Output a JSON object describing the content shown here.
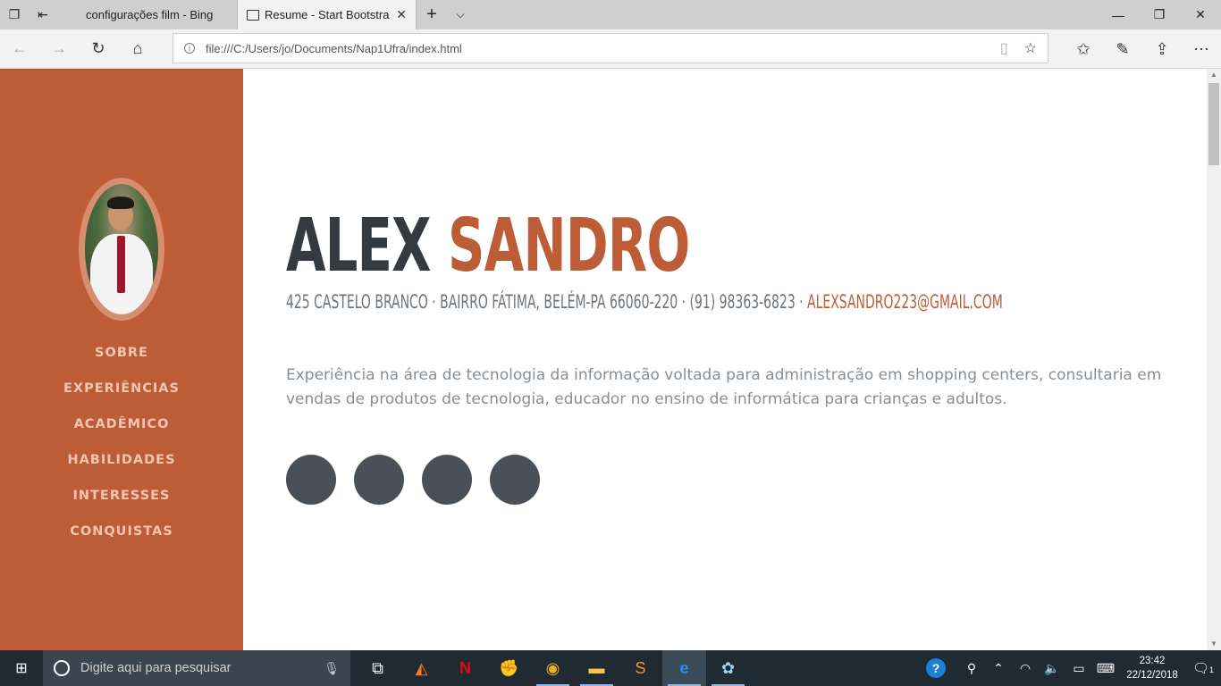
{
  "browser": {
    "tabs": [
      {
        "title": "configurações film - Bing"
      },
      {
        "title": "Resume - Start Bootstra"
      }
    ],
    "address": "file:///C:/Users/jo/Documents/Nap1Ufra/index.html"
  },
  "sidebar": {
    "nav": [
      "SOBRE",
      "EXPERIÊNCIAS",
      "ACADÊMICO",
      "HABILIDADES",
      "INTERESSES",
      "CONQUISTAS"
    ]
  },
  "main": {
    "first_name": "ALEX",
    "last_name": "SANDRO",
    "address_line": "425 Castelo Branco · Bairro Fátima, Belém-PA 66060-220 · (91) 98363-6823 · ",
    "email": "alexsandro223@gmail.com",
    "lead": "Experiência na área de tecnologia da informação voltada para administração em shopping centers, consultaria em vendas de produtos de tecnologia, educador no ensino de informática para crianças e adultos."
  },
  "taskbar": {
    "search_placeholder": "Digite aqui para pesquisar",
    "time": "23:42",
    "date": "22/12/2018",
    "notification_count": "1"
  },
  "colors": {
    "primary": "#bd5d38",
    "heading": "#343a40",
    "muted": "#868e96"
  }
}
